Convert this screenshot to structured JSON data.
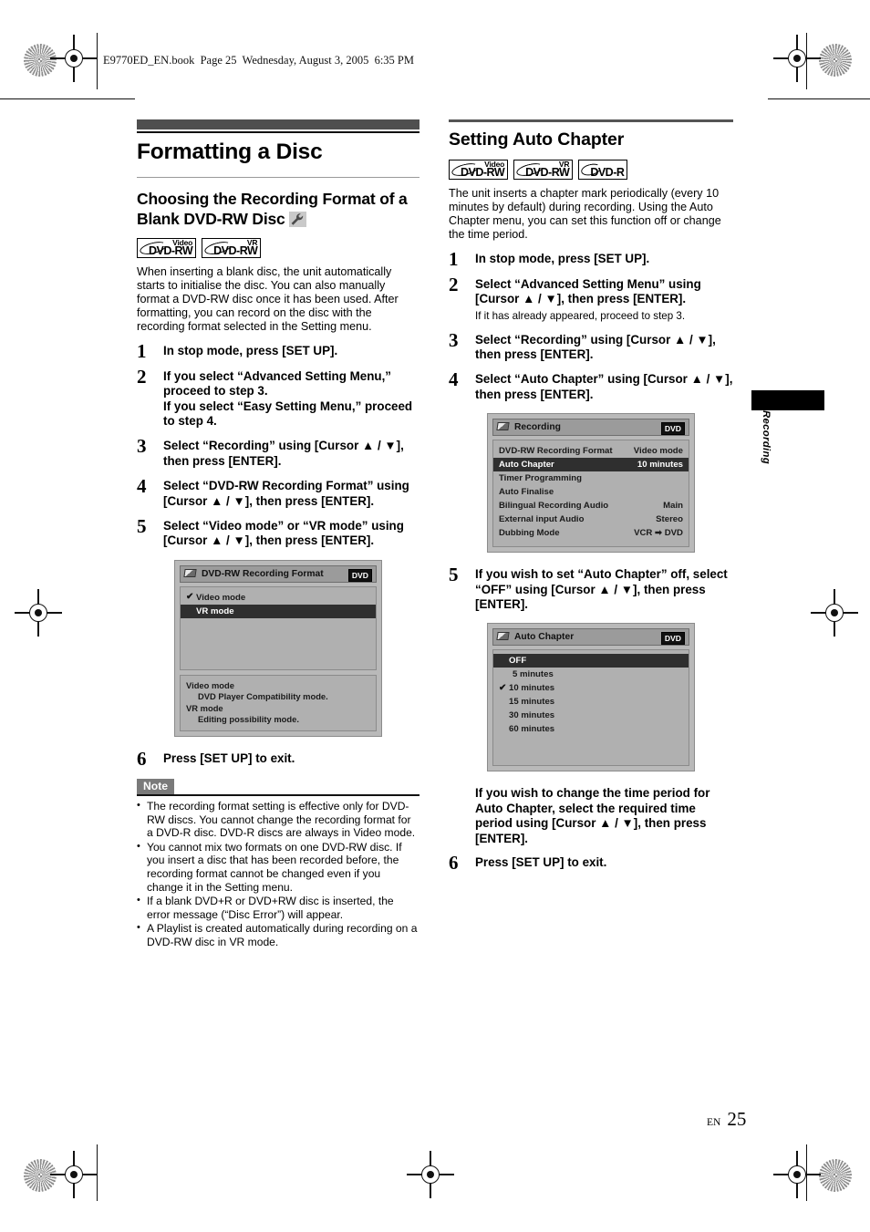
{
  "page": {
    "book_header": "E9770ED_EN.book  Page 25  Wednesday, August 3, 2005  6:35 PM",
    "side_tab_label": "Recording",
    "footer_lang": "EN",
    "footer_page": "25"
  },
  "left": {
    "chapter_title": "Formatting a Disc",
    "subsection_title": "Choosing the Recording Format of a Blank DVD-RW Disc",
    "wrench_icon": "wrench-icon",
    "badges": [
      {
        "type": "Video",
        "name": "DVD-RW"
      },
      {
        "type": "VR",
        "name": "DVD-RW"
      }
    ],
    "intro": "When inserting a blank disc, the unit automatically starts to initialise the disc. You can also manually format a DVD-RW disc once it has been used. After formatting, you can record on the disc with the recording format selected in the Setting menu.",
    "steps": [
      {
        "num": "1",
        "text": "In stop mode, press [SET UP]."
      },
      {
        "num": "2",
        "text": "If you select “Advanced Setting Menu,” proceed to step 3.\nIf you select “Easy Setting Menu,” proceed to step 4."
      },
      {
        "num": "3",
        "text": "Select “Recording” using [Cursor ▲ / ▼], then press [ENTER]."
      },
      {
        "num": "4",
        "text": "Select “DVD-RW Recording Format” using [Cursor ▲ / ▼], then press [ENTER]."
      },
      {
        "num": "5",
        "text": "Select “Video mode” or “VR mode” using [Cursor ▲ / ▼], then press [ENTER]."
      }
    ],
    "osd": {
      "title": "DVD-RW Recording Format",
      "disc_tag": "DVD",
      "rows": [
        {
          "check": "✔",
          "label": "Video mode",
          "value": "",
          "selected": false
        },
        {
          "check": "",
          "label": "VR mode",
          "value": "",
          "selected": true
        }
      ],
      "description": [
        {
          "text": "Video mode",
          "indent": false
        },
        {
          "text": "DVD Player Compatibility mode.",
          "indent": true
        },
        {
          "text": "VR mode",
          "indent": false
        },
        {
          "text": "Editing possibility mode.",
          "indent": true
        }
      ]
    },
    "step6": {
      "num": "6",
      "text": "Press [SET UP] to exit."
    },
    "note_label": "Note",
    "notes": [
      "The recording format setting is effective only for DVD-RW discs. You cannot change the recording format for a DVD-R disc. DVD-R discs are always in Video mode.",
      "You cannot mix two formats on one DVD-RW disc. If you insert a disc that has been recorded before, the recording format cannot be changed even if you change it in the Setting menu.",
      "If a blank DVD+R or DVD+RW disc is inserted, the error message (“Disc Error”) will appear.",
      "A Playlist is created automatically during recording on a DVD-RW disc in VR mode."
    ]
  },
  "right": {
    "section_title": "Setting Auto Chapter",
    "badges": [
      {
        "type": "Video",
        "name": "DVD-RW"
      },
      {
        "type": "VR",
        "name": "DVD-RW"
      },
      {
        "type": "",
        "name": "DVD-R"
      }
    ],
    "intro": "The unit inserts a chapter mark periodically (every 10 minutes by default) during recording. Using the Auto Chapter menu, you can set this function off or change the time period.",
    "steps": [
      {
        "num": "1",
        "text": "In stop mode, press [SET UP].",
        "sub": ""
      },
      {
        "num": "2",
        "text": "Select “Advanced Setting Menu” using [Cursor ▲ / ▼], then press [ENTER].",
        "sub": "If it has already appeared, proceed to step 3."
      },
      {
        "num": "3",
        "text": "Select “Recording” using [Cursor ▲ / ▼], then press [ENTER].",
        "sub": ""
      },
      {
        "num": "4",
        "text": "Select “Auto Chapter” using [Cursor ▲ / ▼], then press [ENTER].",
        "sub": ""
      }
    ],
    "osd_recording": {
      "title": "Recording",
      "disc_tag": "DVD",
      "rows": [
        {
          "label": "DVD-RW Recording Format",
          "value": "Video mode",
          "selected": false
        },
        {
          "label": "Auto Chapter",
          "value": "10 minutes",
          "selected": true
        },
        {
          "label": "Timer Programming",
          "value": "",
          "selected": false
        },
        {
          "label": "Auto Finalise",
          "value": "",
          "selected": false
        },
        {
          "label": "Bilingual Recording Audio",
          "value": "Main",
          "selected": false
        },
        {
          "label": "External input Audio",
          "value": "Stereo",
          "selected": false
        },
        {
          "label": "Dubbing Mode",
          "value": "VCR ➡ DVD",
          "selected": false
        }
      ]
    },
    "step5": {
      "num": "5",
      "text": "If you wish to set “Auto Chapter” off, select “OFF” using [Cursor ▲ / ▼], then press [ENTER]."
    },
    "osd_autochapter": {
      "title": "Auto Chapter",
      "disc_tag": "DVD",
      "rows": [
        {
          "check": "",
          "label": "OFF",
          "selected": true
        },
        {
          "check": "",
          "label": "5 minutes",
          "selected": false
        },
        {
          "check": "✔",
          "label": "10 minutes",
          "selected": false
        },
        {
          "check": "",
          "label": "15 minutes",
          "selected": false
        },
        {
          "check": "",
          "label": "30 minutes",
          "selected": false
        },
        {
          "check": "",
          "label": "60 minutes",
          "selected": false
        }
      ]
    },
    "closing_text": "If you wish to change the time period for Auto Chapter, select the required time period using [Cursor ▲ / ▼], then press [ENTER].",
    "step6": {
      "num": "6",
      "text": "Press [SET UP] to exit."
    }
  }
}
